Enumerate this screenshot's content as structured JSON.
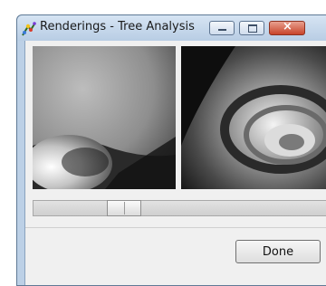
{
  "window": {
    "title": "Renderings - Tree Analysis",
    "app_icon": "renderings-app-icon",
    "controls": {
      "minimize_icon": "minimize-icon",
      "maximize_icon": "maximize-icon",
      "close_icon": "close-icon",
      "close_glyph": "×"
    }
  },
  "renderings": {
    "left_view": "airway-rendering-left",
    "right_view": "airway-rendering-right"
  },
  "slider": {
    "position_fraction": 0.27
  },
  "footer": {
    "done_label": "Done"
  },
  "colors": {
    "titlebar": "#c6d8ec",
    "close_button": "#c8442a",
    "client_bg": "#f0f0f0"
  }
}
